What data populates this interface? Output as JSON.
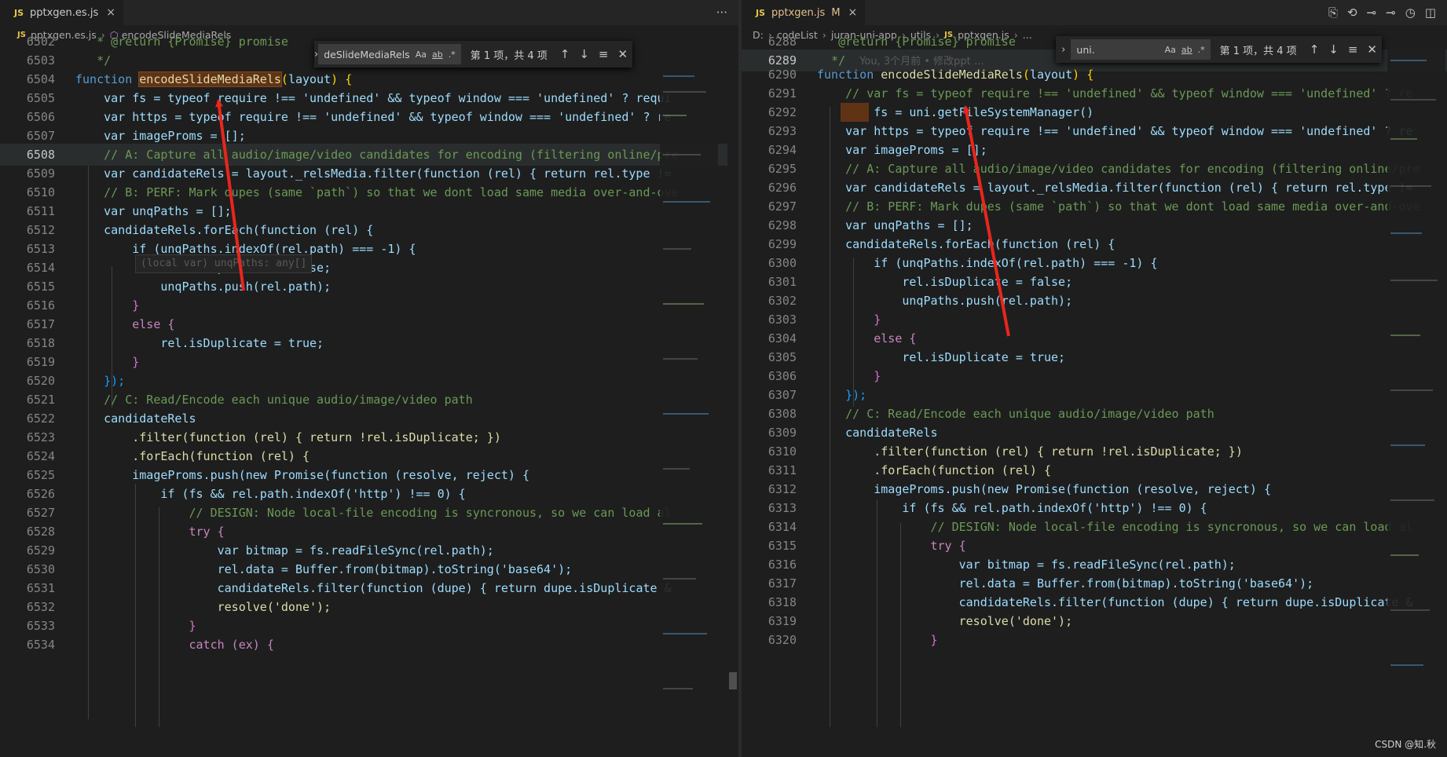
{
  "left": {
    "tab": {
      "lang": "JS",
      "name": "pptxgen.es.js",
      "close": "×"
    },
    "tab_actions": {
      "more": "···"
    },
    "breadcrumb": {
      "lang": "JS",
      "file": "pptxgen.es.js",
      "symbol": "encodeSlideMediaRels"
    },
    "find": {
      "query": "deSlideMediaRels",
      "case": "Aa",
      "word": "ab",
      "regex": ".*",
      "count": "第 1 项，共 4 项"
    },
    "hover_tip": "(local var) unqPaths: any[]"
  },
  "right": {
    "tab": {
      "lang": "JS",
      "name": "pptxgen.js",
      "modified": "M",
      "close": "×"
    },
    "breadcrumb": {
      "drive": "D:",
      "parts": [
        "codeList",
        "juran-uni-app",
        "utils"
      ],
      "lang": "JS",
      "file": "pptxgen.js",
      "tail": "..."
    },
    "find": {
      "query": "uni.",
      "case": "Aa",
      "word": "ab",
      "regex": ".*",
      "count": "第 1 项，共 4 项"
    },
    "blame": "You, 3个月前 • 修改ppt …"
  },
  "watermark": "CSDN @知.秋",
  "code": {
    "ret_comment": "* @return {Promise} promise",
    "close_comment": "*/",
    "fn_name": "encodeSlideMediaRels",
    "fs_decl": "var fs = typeof require !== 'undefined' && typeof window === 'undefined' ? requi",
    "fs_decl_right": "// var fs = typeof require !== 'undefined' && typeof window === 'undefined' ? re",
    "uni_line": "var fs = uni.getFileSystemManager()",
    "https_decl": "var https = typeof require !== 'undefined' && typeof window === 'undefined' ? re",
    "image_proms": "var imageProms = [];",
    "comment_a": "// A: Capture all audio/image/video candidates for encoding (filtering online/pre",
    "candidate": "var candidateRels = layout._relsMedia.filter(function (rel) { return rel.type !=",
    "comment_b": "// B: PERF: Mark dupes (same `path`) so that we dont load same media over-and-ove",
    "unq": "var unqPaths = [];",
    "foreach": "candidateRels.forEach(function (rel) {",
    "if_line": "if (unqPaths.indexOf(rel.path) === -1) {",
    "isdup_false": "rel.isDuplicate = false;",
    "push": "unqPaths.push(rel.path);",
    "close_brace": "}",
    "else": "else {",
    "isdup_true": "rel.isDuplicate = true;",
    "close_paren": "});",
    "comment_c": "// C: Read/Encode each unique audio/image/video path",
    "cand_rels": "candidateRels",
    "filter": ".filter(function (rel) { return !rel.isDuplicate; })",
    "foreach2": ".forEach(function (rel) {",
    "push_promise": "imageProms.push(new Promise(function (resolve, reject) {",
    "if_http": "if (fs && rel.path.indexOf('http') !== 0) {",
    "design": "// DESIGN: Node local-file encoding is syncronous, so we can load al",
    "try": "try {",
    "bitmap": "var bitmap = fs.readFileSync(rel.path);",
    "reldata": "rel.data = Buffer.from(bitmap).toString('base64');",
    "cand_filter": "candidateRels.filter(function (dupe) { return dupe.isDuplicate &",
    "resolve": "resolve('done');",
    "catch": "catch (ex) {",
    "partial_ret": "@return {Promise} promise"
  },
  "left_line_numbers": [
    "6502",
    "6503",
    "6504",
    "6505",
    "6506",
    "6507",
    "6508",
    "6509",
    "6510",
    "6511",
    "6512",
    "6513",
    "6514",
    "6515",
    "6516",
    "6517",
    "6518",
    "6519",
    "6520",
    "6521",
    "6522",
    "6523",
    "6524",
    "6525",
    "6526",
    "6527",
    "6528",
    "6529",
    "6530",
    "6531",
    "6532",
    "6533",
    "6534"
  ],
  "right_line_numbers": [
    "6288",
    "6289",
    "6290",
    "6291",
    "6292",
    "6293",
    "6294",
    "6295",
    "6296",
    "6297",
    "6298",
    "6299",
    "6300",
    "6301",
    "6302",
    "6303",
    "6304",
    "6305",
    "6306",
    "6307",
    "6308",
    "6309",
    "6310",
    "6311",
    "6312",
    "6313",
    "6314",
    "6315",
    "6316",
    "6317",
    "6318",
    "6319",
    "6320"
  ],
  "colors": {
    "bg": "#1e1e1e",
    "keyword": "#569cd6",
    "function": "#dcdcaa",
    "string": "#ce9178",
    "comment": "#6a9955",
    "arrow": "#e8261d",
    "find_highlight": "#613315"
  }
}
